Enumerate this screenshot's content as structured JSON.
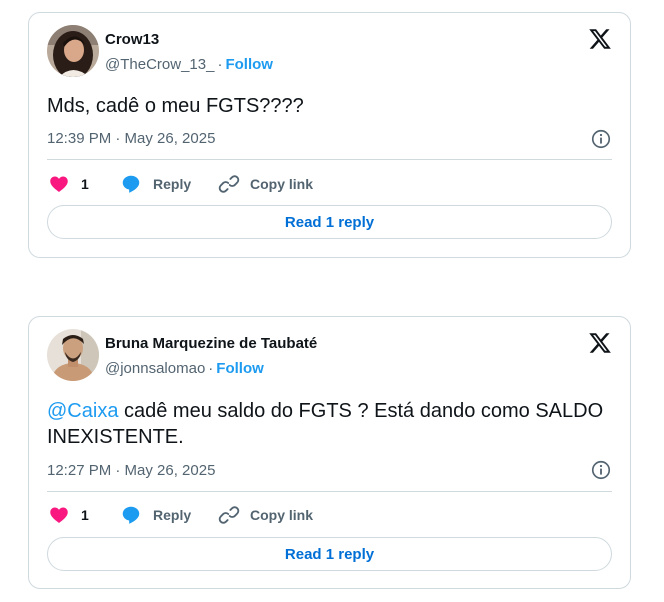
{
  "tweets": [
    {
      "author_name": "Crow13",
      "handle": "@TheCrow_13_",
      "separator": "·",
      "follow_label": "Follow",
      "mention": "",
      "text": "Mds, cadê o meu FGTS????",
      "timestamp": "12:39 PM · May 26, 2025",
      "like_count": "1",
      "reply_label": "Reply",
      "copy_link_label": "Copy link",
      "read_replies_label": "Read 1 reply",
      "avatar_icon": "profile-photo-woman",
      "platform_icon": "x-logo"
    },
    {
      "author_name": "Bruna Marquezine de Taubaté",
      "handle": "@jonnsalomao",
      "separator": "·",
      "follow_label": "Follow",
      "mention": "@Caixa",
      "text": " cadê meu saldo do FGTS ? Está dando como SALDO INEXISTENTE.",
      "timestamp": "12:27 PM · May 26, 2025",
      "like_count": "1",
      "reply_label": "Reply",
      "copy_link_label": "Copy link",
      "read_replies_label": "Read 1 reply",
      "avatar_icon": "profile-photo-man",
      "platform_icon": "x-logo"
    }
  ],
  "colors": {
    "accent": "#1d9bf0",
    "like": "#f91880",
    "text": "#0f1419",
    "muted": "#536471",
    "border": "#cfd9de",
    "read_button_text": "#006fd6"
  }
}
